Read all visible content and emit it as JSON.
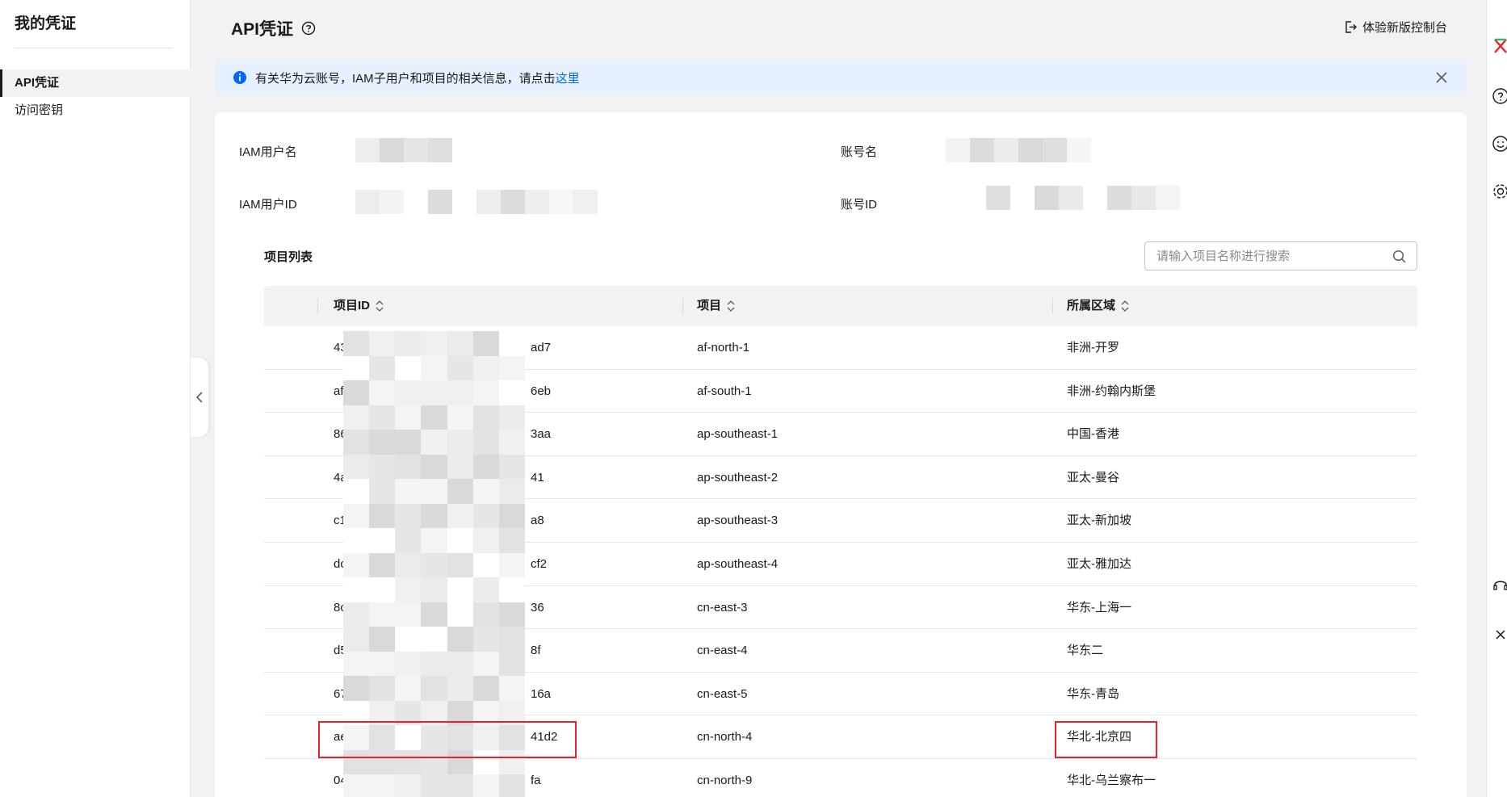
{
  "sidebar": {
    "title": "我的凭证",
    "items": [
      {
        "label": "API凭证",
        "active": true
      },
      {
        "label": "访问密钥",
        "active": false
      }
    ]
  },
  "header": {
    "title": "API凭证",
    "help_icon": "question-circle-icon",
    "new_console_label": "体验新版控制台",
    "new_console_icon": "exit-icon"
  },
  "notice": {
    "icon": "info-icon",
    "text": "有关华为云账号，IAM子用户和项目的相关信息，请点击",
    "link": "这里",
    "close_icon": "close-icon"
  },
  "info": {
    "iam_user_name_label": "IAM用户名",
    "account_name_label": "账号名",
    "iam_user_id_label": "IAM用户ID",
    "account_id_label": "账号ID"
  },
  "projects": {
    "title": "项目列表",
    "search_placeholder": "请输入项目名称进行搜索",
    "columns": [
      "项目ID",
      "项目",
      "所属区域"
    ],
    "rows": [
      {
        "id_prefix": "43",
        "id_suffix": "ad7",
        "project": "af-north-1",
        "region": "非洲-开罗"
      },
      {
        "id_prefix": "af",
        "id_suffix": "6eb",
        "project": "af-south-1",
        "region": "非洲-约翰内斯堡"
      },
      {
        "id_prefix": "86",
        "id_suffix": "3aa",
        "project": "ap-southeast-1",
        "region": "中国-香港"
      },
      {
        "id_prefix": "4a",
        "id_suffix": "41",
        "project": "ap-southeast-2",
        "region": "亚太-曼谷"
      },
      {
        "id_prefix": "c1",
        "id_suffix": "a8",
        "project": "ap-southeast-3",
        "region": "亚太-新加坡"
      },
      {
        "id_prefix": "dc",
        "id_suffix": "cf2",
        "project": "ap-southeast-4",
        "region": "亚太-雅加达"
      },
      {
        "id_prefix": "8c",
        "id_suffix": "36",
        "project": "cn-east-3",
        "region": "华东-上海一"
      },
      {
        "id_prefix": "d5",
        "id_suffix": "8f",
        "project": "cn-east-4",
        "region": "华东二"
      },
      {
        "id_prefix": "67",
        "id_suffix": "16a",
        "project": "cn-east-5",
        "region": "华东-青岛"
      },
      {
        "id_prefix": "ae",
        "id_suffix": "41d2",
        "project": "cn-north-4",
        "region": "华北-北京四",
        "highlighted": true
      },
      {
        "id_prefix": "04",
        "id_suffix": "fa",
        "project": "cn-north-9",
        "region": "华北-乌兰察布一"
      }
    ]
  },
  "colors": {
    "accent": "#0066ff",
    "highlight": "#e8212b",
    "notice_bg": "#e6f0ff"
  }
}
